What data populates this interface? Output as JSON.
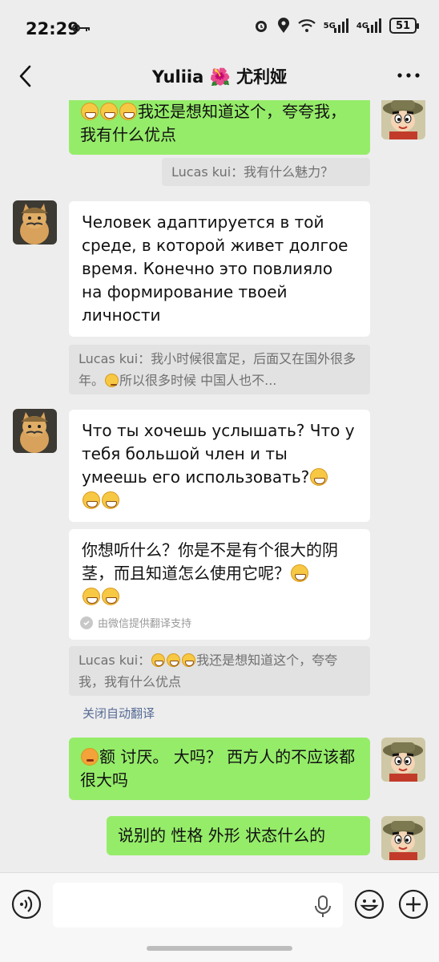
{
  "status": {
    "time": "22:29",
    "battery": "51",
    "net1": "5G",
    "net2": "4G"
  },
  "header": {
    "title": "Yuliia 🌺 尤利娅"
  },
  "messages": {
    "m1": "我还是想知道这个，夸夸我，我有什么优点",
    "q1": "Lucas kui：我有什么魅力？",
    "m2": "Человек адаптируется в той среде, в которой живет долгое время. Конечно это повлияло на формирование твоей личности",
    "q2_a": "Lucas kui：我小时候很富足，后面又在国外很多年。",
    "q2_b": "所以很多时候 中国人也不...",
    "m3": "Что ты хочешь услышать? Что у тебя большой член и ты умеешь его использовать?",
    "m3_trans": "你想听什么？你是不是有个很大的阴茎，而且知道怎么使用它呢？",
    "trans_note": "由微信提供翻译支持",
    "q3_a": "Lucas kui：",
    "q3_b": "我还是想知道这个，夸夸我，我有什么优点",
    "auto_translate_off": "关闭自动翻译",
    "m4": "额 讨厌。 大吗？ 西方人的不应该都很大吗",
    "m5": "说别的 性格 外形 状态什么的"
  },
  "colors": {
    "own_bubble": "#95ec69",
    "other_bubble": "#ffffff",
    "link": "#576b95",
    "background": "#ededed"
  },
  "icons": {
    "back": "back-arrow-icon",
    "more": "more-dots-icon",
    "voice": "voice-icon",
    "mic": "mic-icon",
    "emoji": "emoji-icon",
    "plus": "plus-icon"
  }
}
